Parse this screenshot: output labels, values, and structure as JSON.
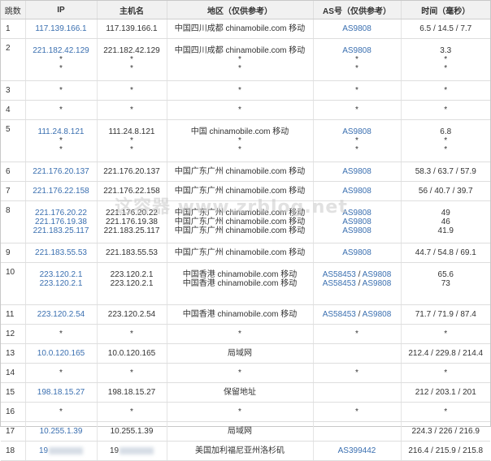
{
  "header": {
    "hop": "跳数",
    "ip": "IP",
    "host": "主机名",
    "region": "地区（仅供参考）",
    "as": "AS号（仅供参考）",
    "time": "时间（毫秒）"
  },
  "watermark": "这容器 www.zrblog.net",
  "rows": [
    {
      "hop": "1",
      "ip": [
        "117.139.166.1"
      ],
      "host": [
        "117.139.166.1"
      ],
      "region": [
        "中国四川成都 chinamobile.com 移动"
      ],
      "as": [
        [
          "AS9808"
        ]
      ],
      "time": [
        "6.5 / 14.5 / 7.7"
      ]
    },
    {
      "hop": "2",
      "ip": [
        "221.182.42.129",
        "*",
        "*"
      ],
      "host": [
        "221.182.42.129",
        "*",
        "*"
      ],
      "region": [
        "中国四川成都 chinamobile.com 移动",
        "*",
        "*"
      ],
      "as": [
        [
          "AS9808"
        ],
        [
          "*"
        ],
        [
          "*"
        ]
      ],
      "time": [
        "3.3",
        "*",
        "*"
      ]
    },
    {
      "hop": "3",
      "ip": [
        "*"
      ],
      "host": [
        "*"
      ],
      "region": [
        "*"
      ],
      "as": [
        [
          "*"
        ]
      ],
      "time": [
        "*"
      ]
    },
    {
      "hop": "4",
      "ip": [
        "*"
      ],
      "host": [
        "*"
      ],
      "region": [
        "*"
      ],
      "as": [
        [
          "*"
        ]
      ],
      "time": [
        "*"
      ]
    },
    {
      "hop": "5",
      "ip": [
        "111.24.8.121",
        "*",
        "*"
      ],
      "host": [
        "111.24.8.121",
        "*",
        "*"
      ],
      "region": [
        "中国 chinamobile.com 移动",
        "*",
        "*"
      ],
      "as": [
        [
          "AS9808"
        ],
        [
          "*"
        ],
        [
          "*"
        ]
      ],
      "time": [
        "6.8",
        "*",
        "*"
      ]
    },
    {
      "hop": "6",
      "ip": [
        "221.176.20.137"
      ],
      "host": [
        "221.176.20.137"
      ],
      "region": [
        "中国广东广州 chinamobile.com 移动"
      ],
      "as": [
        [
          "AS9808"
        ]
      ],
      "time": [
        "58.3 / 63.7 / 57.9"
      ]
    },
    {
      "hop": "7",
      "ip": [
        "221.176.22.158"
      ],
      "host": [
        "221.176.22.158"
      ],
      "region": [
        "中国广东广州 chinamobile.com 移动"
      ],
      "as": [
        [
          "AS9808"
        ]
      ],
      "time": [
        "56 / 40.7 / 39.7"
      ]
    },
    {
      "hop": "8",
      "ip": [
        "221.176.20.22",
        "221.176.19.38",
        "221.183.25.117"
      ],
      "host": [
        "221.176.20.22",
        "221.176.19.38",
        "221.183.25.117"
      ],
      "region": [
        "中国广东广州 chinamobile.com 移动",
        "中国广东广州 chinamobile.com 移动",
        "中国广东广州 chinamobile.com 移动"
      ],
      "as": [
        [
          "AS9808"
        ],
        [
          "AS9808"
        ],
        [
          "AS9808"
        ]
      ],
      "time": [
        "49",
        "46",
        "41.9"
      ]
    },
    {
      "hop": "9",
      "ip": [
        "221.183.55.53"
      ],
      "host": [
        "221.183.55.53"
      ],
      "region": [
        "中国广东广州 chinamobile.com 移动"
      ],
      "as": [
        [
          "AS9808"
        ]
      ],
      "time": [
        "44.7 / 54.8 / 69.1"
      ]
    },
    {
      "hop": "10",
      "ip": [
        "223.120.2.1",
        "223.120.2.1",
        ""
      ],
      "host": [
        "223.120.2.1",
        "223.120.2.1",
        ""
      ],
      "region": [
        "中国香港 chinamobile.com 移动",
        "中国香港 chinamobile.com 移动",
        ""
      ],
      "as": [
        [
          "AS58453",
          "AS9808"
        ],
        [
          "AS58453",
          "AS9808"
        ],
        []
      ],
      "time": [
        "65.6",
        "73",
        ""
      ]
    },
    {
      "hop": "11",
      "ip": [
        "223.120.2.54"
      ],
      "host": [
        "223.120.2.54"
      ],
      "region": [
        "中国香港 chinamobile.com 移动"
      ],
      "as": [
        [
          "AS58453",
          "AS9808"
        ]
      ],
      "time": [
        "71.7 / 71.9 / 87.4"
      ]
    },
    {
      "hop": "12",
      "ip": [
        "*"
      ],
      "host": [
        "*"
      ],
      "region": [
        "*"
      ],
      "as": [
        [
          "*"
        ]
      ],
      "time": [
        "*"
      ]
    },
    {
      "hop": "13",
      "ip": [
        "10.0.120.165"
      ],
      "host": [
        "10.0.120.165"
      ],
      "region": [
        "局域网"
      ],
      "as": [
        []
      ],
      "time": [
        "212.4 / 229.8 / 214.4"
      ]
    },
    {
      "hop": "14",
      "ip": [
        "*"
      ],
      "host": [
        "*"
      ],
      "region": [
        "*"
      ],
      "as": [
        [
          "*"
        ]
      ],
      "time": [
        "*"
      ]
    },
    {
      "hop": "15",
      "ip": [
        "198.18.15.27"
      ],
      "host": [
        "198.18.15.27"
      ],
      "region": [
        "保留地址"
      ],
      "as": [
        []
      ],
      "time": [
        "212 / 203.1 / 201"
      ]
    },
    {
      "hop": "16",
      "ip": [
        "*"
      ],
      "host": [
        "*"
      ],
      "region": [
        "*"
      ],
      "as": [
        [
          "*"
        ]
      ],
      "time": [
        "*"
      ]
    },
    {
      "hop": "17",
      "ip": [
        "10.255.1.39"
      ],
      "host": [
        "10.255.1.39"
      ],
      "region": [
        "局域网"
      ],
      "as": [
        []
      ],
      "time": [
        "224.3 / 226 / 216.9"
      ]
    },
    {
      "hop": "18",
      "ip": [
        "19"
      ],
      "host": [
        "19"
      ],
      "region": [
        "美国加利福尼亚州洛杉矶"
      ],
      "as": [
        [
          "AS399442"
        ]
      ],
      "time": [
        "216.4 / 215.9 / 215.8"
      ],
      "redacted": true
    }
  ]
}
